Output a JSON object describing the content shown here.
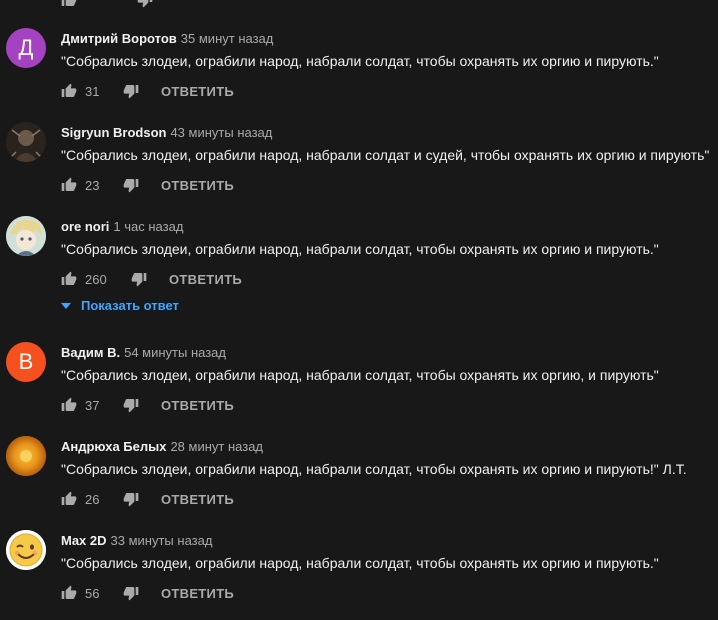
{
  "colors": {
    "background": "#181818",
    "text": "#f1f1f1",
    "meta": "#aaaaaa",
    "link": "#3ea6ff"
  },
  "reply_label": "ОТВЕТИТЬ",
  "comments": [
    {
      "avatar_letter": "Д",
      "avatar_color": "#a542c2",
      "author": "Дмитрий Воротов",
      "time": "35 минут назад",
      "text": "\"Собрались злодеи, ограбили народ, набрали солдат, чтобы охранять их оргию и пирують.\"",
      "likes": "31"
    },
    {
      "avatar_letter": "",
      "avatar_color": "#3a2f28",
      "author": "Sigryun Brodson",
      "time": "43 минуты назад",
      "text": "\"Собрались злодеи, ограбили народ, набрали солдат и судей, чтобы охранять их оргию и пирують\"",
      "likes": "23"
    },
    {
      "avatar_letter": "",
      "avatar_color": "#d8c9a8",
      "author": "ore nori",
      "time": "1 час назад",
      "text": "\"Собрались злодеи, ограбили народ, набрали солдат, чтобы охранять их оргию и пирують.\"",
      "likes": "260",
      "show_reply": "Показать ответ"
    },
    {
      "avatar_letter": "В",
      "avatar_color": "#f4511e",
      "author": "Вадим В.",
      "time": "54 минуты назад",
      "text": "\"Собрались злодеи, ограбили народ, набрали солдат, чтобы охранять их оргию, и пирують\"",
      "likes": "37"
    },
    {
      "avatar_letter": "",
      "avatar_color": "#d88a1a",
      "author": "Андрюха Белых",
      "time": "28 минут назад",
      "text": "\"Собрались злодеи, ограбили народ, набрали солдат, чтобы охранять их оргию и пирують!\" Л.Т.",
      "likes": "26"
    },
    {
      "avatar_letter": "",
      "avatar_color": "#f7c948",
      "author": "Max 2D",
      "time": "33 минуты назад",
      "text": "\"Собрались злодеи, ограбили народ, набрали солдат, чтобы охранять их оргию и пирують.\"",
      "likes": "56"
    }
  ]
}
